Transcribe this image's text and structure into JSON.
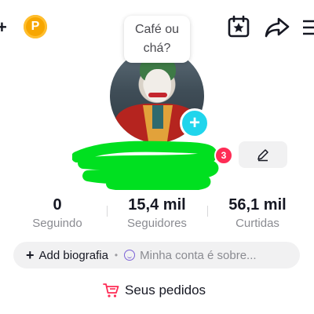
{
  "topbar": {
    "add_label": "+",
    "coin_label": "P",
    "icons": [
      "plus-icon",
      "coin-icon",
      "calendar-star-icon",
      "share-icon",
      "menu-icon"
    ]
  },
  "profile": {
    "bubble_text": "Café ou chá?",
    "notification_count": "3",
    "avatar_add": "+"
  },
  "stats": [
    {
      "value": "0",
      "label": "Seguindo"
    },
    {
      "value": "15,4 mil",
      "label": "Seguidores"
    },
    {
      "value": "56,1 mil",
      "label": "Curtidas"
    }
  ],
  "bio": {
    "add_label": "Add biografia",
    "separator": "•",
    "placeholder": "Minha conta é sobre..."
  },
  "orders": {
    "label": "Seus pedidos"
  },
  "colors": {
    "accent_cyan": "#20d5ec",
    "badge_red": "#fe2c55",
    "coin_gold": "#f7a600",
    "redaction_green": "#00e020"
  }
}
